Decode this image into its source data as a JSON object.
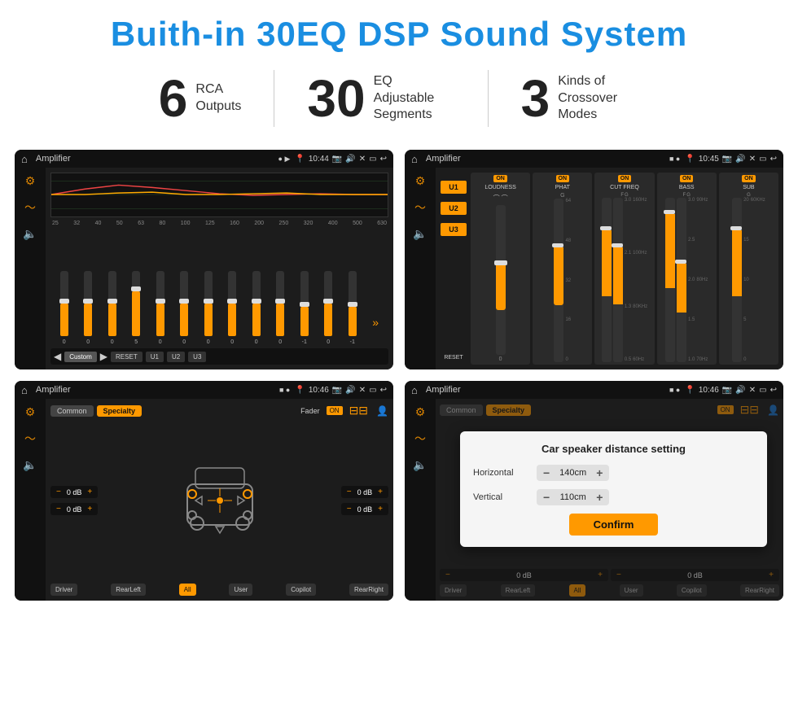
{
  "page": {
    "title": "Buith-in 30EQ DSP Sound System"
  },
  "stats": [
    {
      "number": "6",
      "label_line1": "RCA",
      "label_line2": "Outputs"
    },
    {
      "number": "30",
      "label_line1": "EQ Adjustable",
      "label_line2": "Segments"
    },
    {
      "number": "3",
      "label_line1": "Kinds of",
      "label_line2": "Crossover Modes"
    }
  ],
  "screens": {
    "top_left": {
      "title": "Amplifier",
      "time": "10:44",
      "freq_labels": [
        "25",
        "32",
        "40",
        "50",
        "63",
        "80",
        "100",
        "125",
        "160",
        "200",
        "250",
        "320",
        "400",
        "500",
        "630"
      ],
      "eq_values": [
        "0",
        "0",
        "0",
        "5",
        "0",
        "0",
        "0",
        "0",
        "0",
        "0",
        "-1",
        "0",
        "-1"
      ],
      "preset": "Custom",
      "buttons": [
        "RESET",
        "U1",
        "U2",
        "U3"
      ]
    },
    "top_right": {
      "title": "Amplifier",
      "time": "10:45",
      "channels": [
        "LOUDNESS",
        "PHAT",
        "CUT FREQ",
        "BASS",
        "SUB"
      ],
      "u_buttons": [
        "U1",
        "U2",
        "U3"
      ],
      "reset_label": "RESET"
    },
    "bottom_left": {
      "title": "Amplifier",
      "time": "10:46",
      "tabs": [
        "Common",
        "Specialty"
      ],
      "fader_label": "Fader",
      "on_label": "ON",
      "db_values": [
        "0 dB",
        "0 dB",
        "0 dB",
        "0 dB"
      ],
      "bottom_buttons": [
        "Driver",
        "All",
        "User",
        "Copilot",
        "RearLeft",
        "RearRight"
      ]
    },
    "bottom_right": {
      "title": "Amplifier",
      "time": "10:46",
      "tabs": [
        "Common",
        "Specialty"
      ],
      "on_label": "ON",
      "dialog": {
        "title": "Car speaker distance setting",
        "horizontal_label": "Horizontal",
        "horizontal_value": "140cm",
        "vertical_label": "Vertical",
        "vertical_value": "110cm",
        "confirm_label": "Confirm",
        "db_values": [
          "0 dB",
          "0 dB"
        ]
      },
      "bottom_buttons": [
        "Driver",
        "RearLeft",
        "All",
        "User",
        "Copilot",
        "RearRight"
      ]
    }
  }
}
